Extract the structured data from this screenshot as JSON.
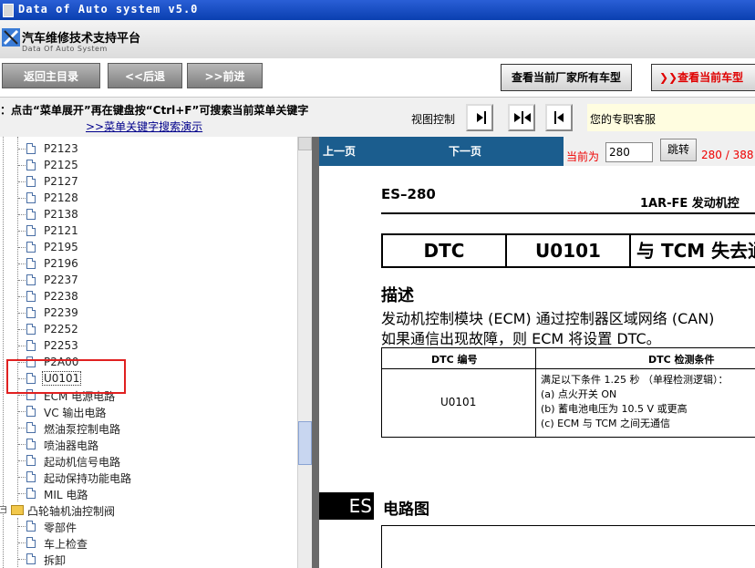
{
  "window": {
    "title": "Data of Auto system v5.0"
  },
  "header": {
    "title": "汽车维修技术支持平台",
    "subtitle": "Data Of Auto System"
  },
  "nav": {
    "home": "返回主目录",
    "back": "<<后退",
    "forward": ">>前进",
    "all_models": "查看当前厂家所有车型",
    "current_model": "查看当前车型"
  },
  "hint": {
    "line1": "提示：点击“菜单展开”再在键盘按“Ctrl+F”可搜索当前菜单关键字",
    "demo_link": ">>菜单关键字搜索演示",
    "view_control": "视图控制",
    "service": "您的专职客服"
  },
  "tree": {
    "items": [
      "P2123",
      "P2125",
      "P2127",
      "P2128",
      "P2138",
      "P2121",
      "P2195",
      "P2196",
      "P2237",
      "P2238",
      "P2239",
      "P2252",
      "P2253",
      "P2A00",
      "U0101",
      "ECM 电源电路",
      "VC 输出电路",
      "燃油泵控制电路",
      "喷油器电路",
      "起动机信号电路",
      "起动保持功能电路",
      "MIL 电路"
    ],
    "folder": "凸轮轴机油控制阀",
    "folder_items": [
      "零部件",
      "车上检查",
      "拆卸"
    ],
    "selected": "U0101"
  },
  "viewer": {
    "prev": "上一页",
    "next": "下一页",
    "current_label": "当前为",
    "page_value": "280",
    "jump": "跳转",
    "page_count": "280 / 388"
  },
  "doc": {
    "code": "ES–280",
    "header": "1AR-FE 发动机控",
    "dtc_label": "DTC",
    "dtc_code": "U0101",
    "dtc_title": "与 TCM 失去通",
    "desc_title": "描述",
    "desc_line1": "发动机控制模块 (ECM) 通过控制器区域网络 (CAN)",
    "desc_line2": "如果通信出现故障，则 ECM 将设置 DTC。",
    "table": {
      "col1": "DTC 编号",
      "col2": "DTC 检测条件",
      "code": "U0101",
      "cond": [
        "满足以下条件 1.25 秒 （单程检测逻辑）：",
        "(a)  点火开关 ON",
        "(b)  蓄电池电压为 10.5 V 或更高",
        "(c)  ECM 与 TCM 之间无通信"
      ]
    },
    "es_badge": "ES",
    "circuit_title": "电路图"
  }
}
